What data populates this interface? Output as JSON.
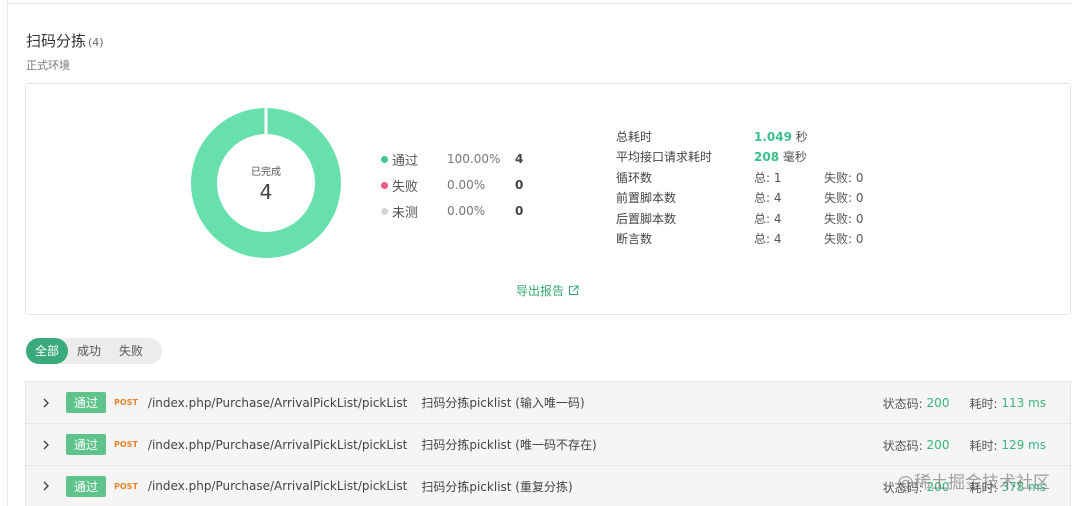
{
  "header": {
    "title": "扫码分拣",
    "count": "(4)",
    "subtitle": "正式环境"
  },
  "summary": {
    "center_label": "已完成",
    "center_value": "4",
    "legend": [
      {
        "name": "通过",
        "percent": "100.00%",
        "count": "4",
        "color": "#3dca8c"
      },
      {
        "name": "失败",
        "percent": "0.00%",
        "count": "0",
        "color": "#ec5b80"
      },
      {
        "name": "未测",
        "percent": "0.00%",
        "count": "0",
        "color": "#d5d5d5"
      }
    ],
    "donut_color": "#68e0ad",
    "pass_fraction": 1.0,
    "stats": {
      "total_time": {
        "label": "总耗时",
        "value": "1.049",
        "unit": "秒"
      },
      "avg_time": {
        "label": "平均接口请求耗时",
        "value": "208",
        "unit": "毫秒"
      },
      "loops": {
        "label": "循环数",
        "total": "总: 1",
        "fail": "失败: 0"
      },
      "pre_scripts": {
        "label": "前置脚本数",
        "total": "总: 4",
        "fail": "失败: 0"
      },
      "post_scripts": {
        "label": "后置脚本数",
        "total": "总: 4",
        "fail": "失败: 0"
      },
      "asserts": {
        "label": "断言数",
        "total": "总: 4",
        "fail": "失败: 0"
      }
    },
    "export_label": "导出报告"
  },
  "tabs": [
    {
      "label": "全部",
      "active": true
    },
    {
      "label": "成功",
      "active": false
    },
    {
      "label": "失败",
      "active": false
    }
  ],
  "results": [
    {
      "badge": "通过",
      "method": "POST",
      "path": "/index.php/Purchase/ArrivalPickList/pickList",
      "name": "扫码分拣picklist (输入唯一码)",
      "status_label": "状态码:",
      "status": "200",
      "time_label": "耗时:",
      "time": "113 ms"
    },
    {
      "badge": "通过",
      "method": "POST",
      "path": "/index.php/Purchase/ArrivalPickList/pickList",
      "name": "扫码分拣picklist (唯一码不存在)",
      "status_label": "状态码:",
      "status": "200",
      "time_label": "耗时:",
      "time": "129 ms"
    },
    {
      "badge": "通过",
      "method": "POST",
      "path": "/index.php/Purchase/ArrivalPickList/pickList",
      "name": "扫码分拣picklist (重复分拣)",
      "status_label": "状态码:",
      "status": "200",
      "time_label": "耗时:",
      "time": "378 ms"
    }
  ],
  "watermark": "@稀土掘金技术社区"
}
